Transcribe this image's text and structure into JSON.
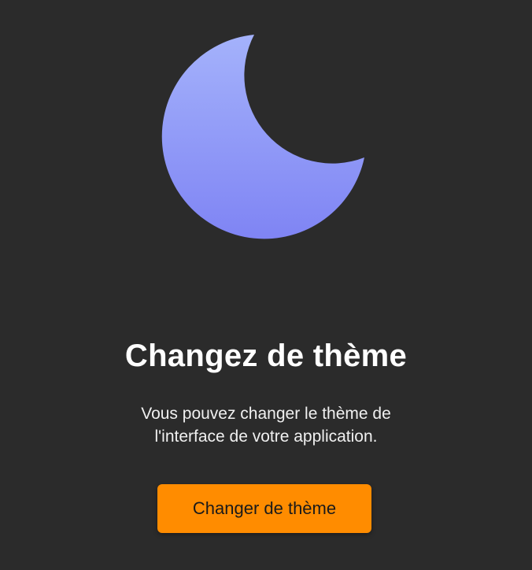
{
  "screen": {
    "title": "Changez de thème",
    "description_lines": [
      "Vous pouvez changer le thème de",
      "l'interface de votre application."
    ],
    "button_label": "Changer de thème"
  },
  "icons": {
    "hero": "moon-icon"
  },
  "colors": {
    "background": "#2b2b2b",
    "accent": "#ff8c00",
    "moon_gradient_top": "#a4b2fb",
    "moon_gradient_bottom": "#7f84f4"
  }
}
